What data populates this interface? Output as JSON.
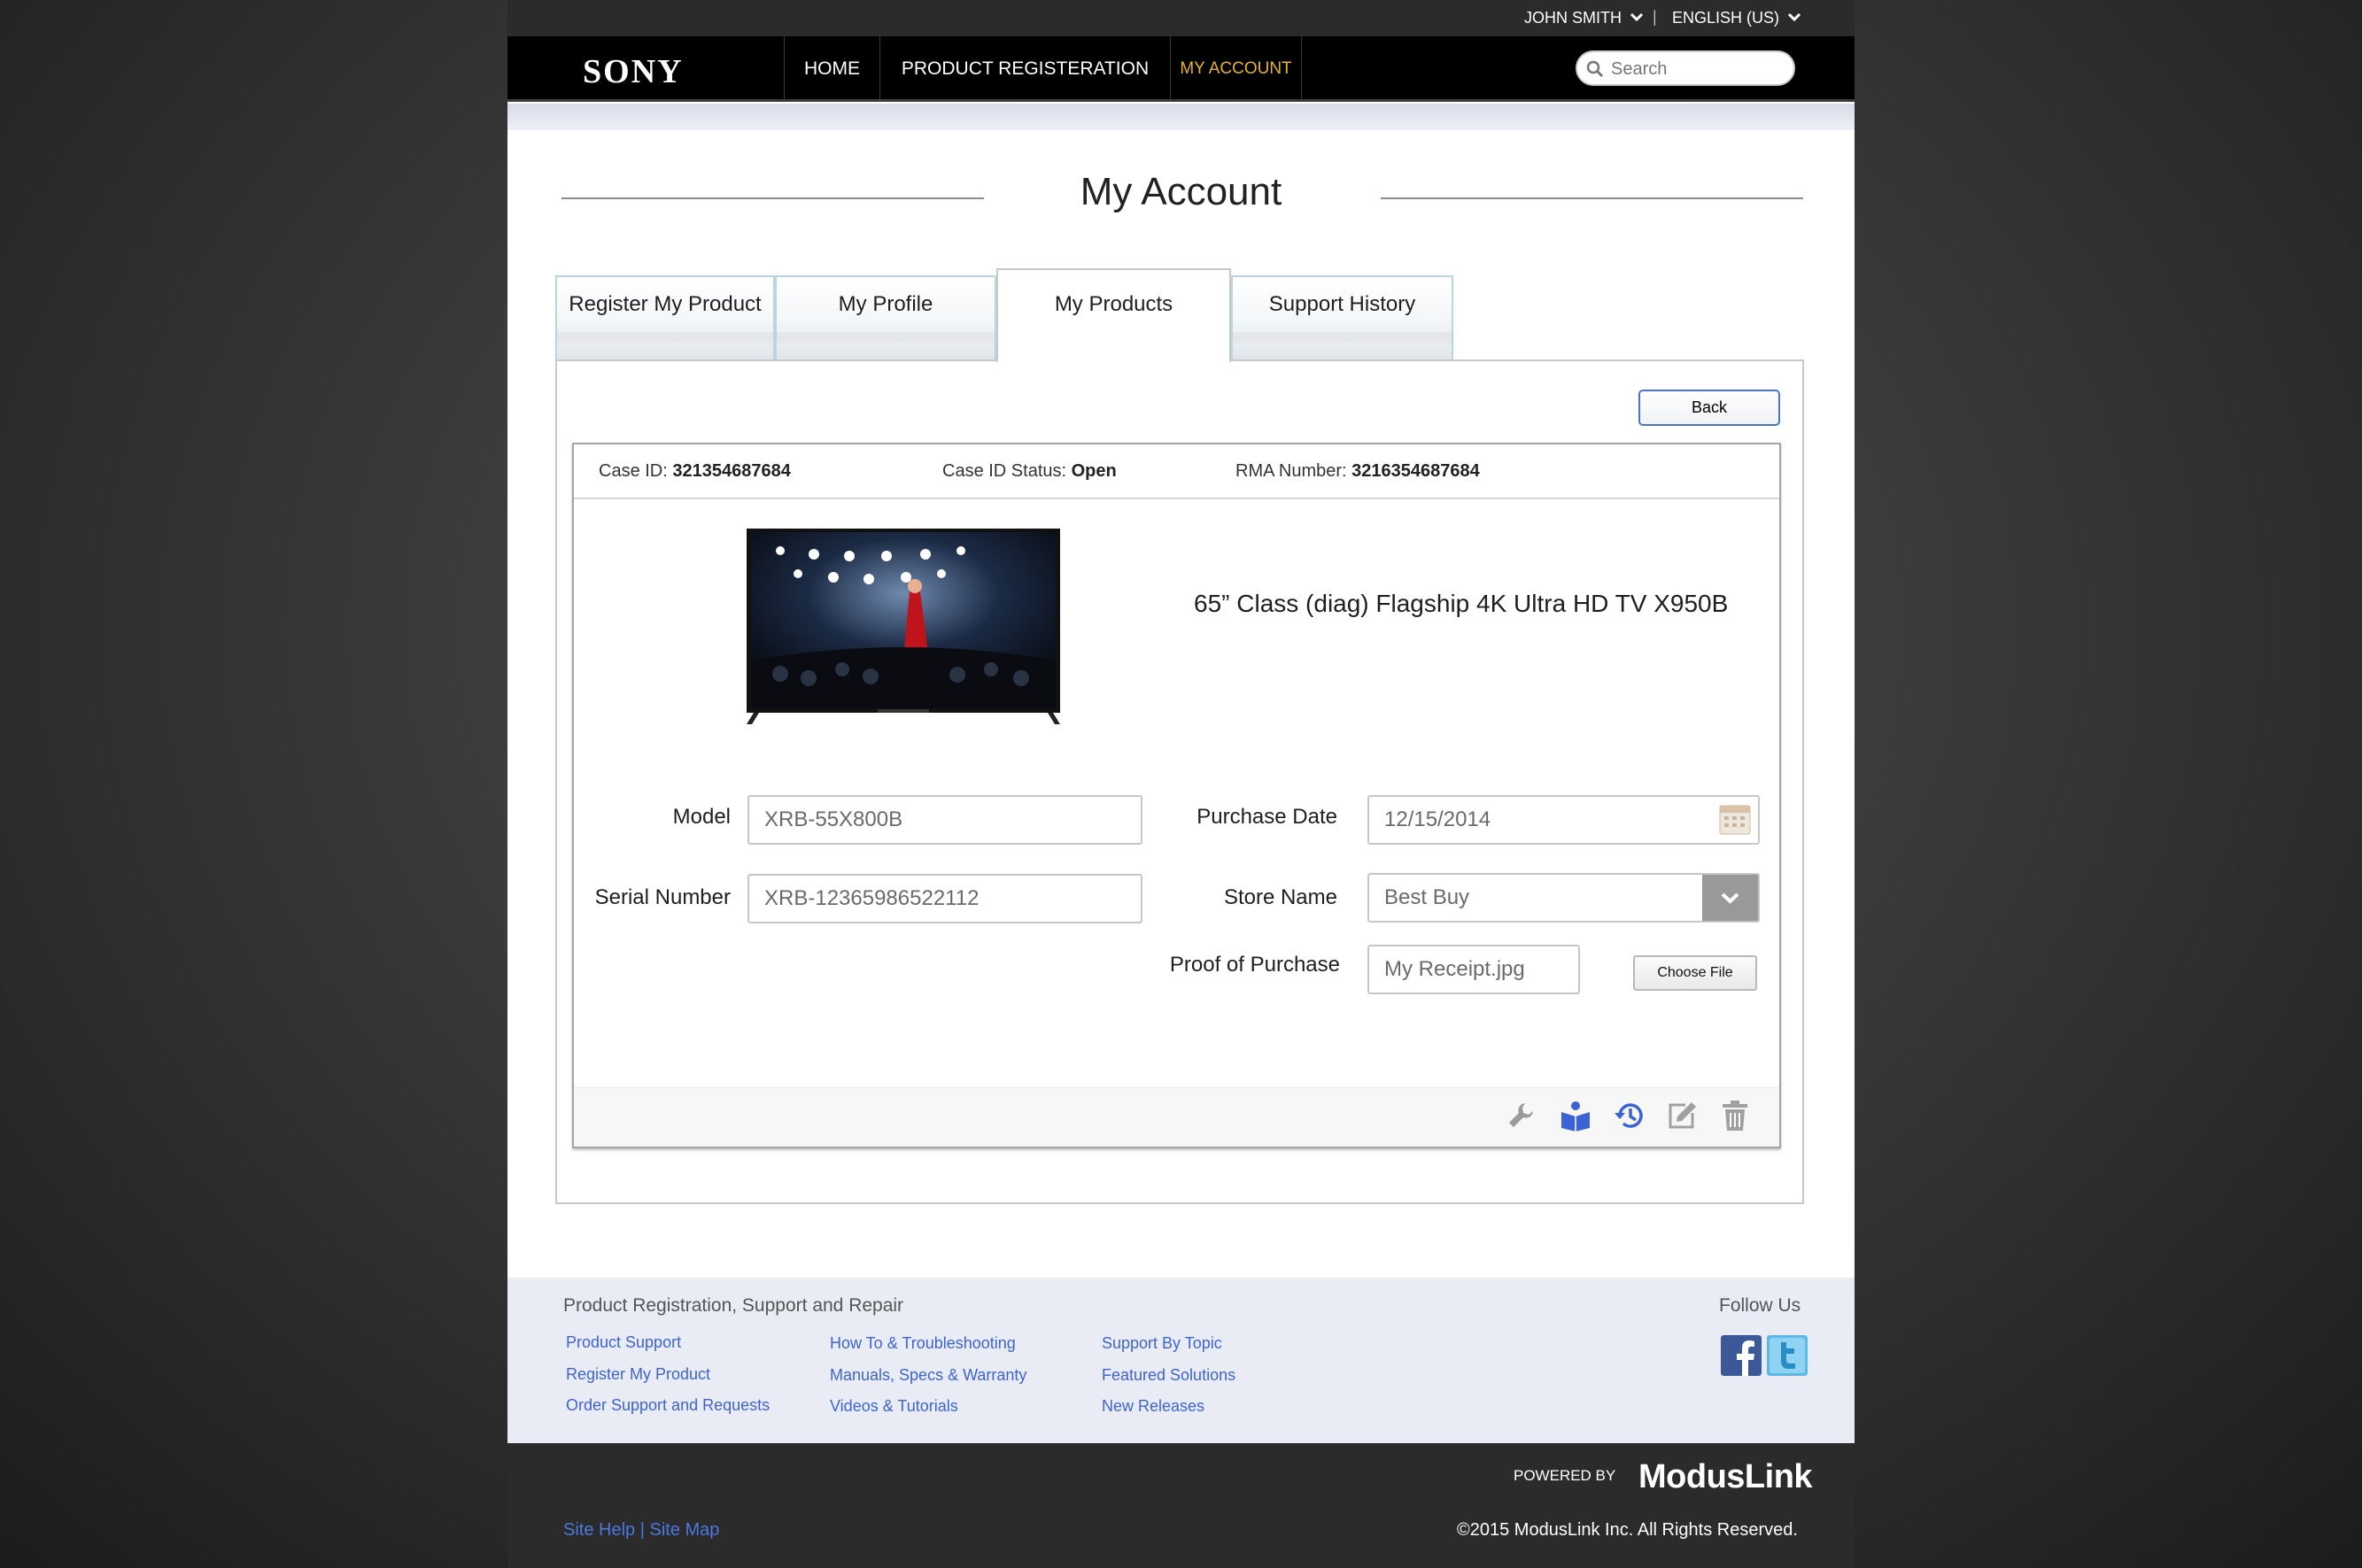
{
  "colors": {
    "accent_nav": "#e6b526",
    "link": "#3e64d4",
    "tab_border": "#b8d6de",
    "button_border": "#4a74c8"
  },
  "topbar": {
    "user": "JOHN SMITH",
    "separator": "|",
    "language": "ENGLISH (US)"
  },
  "nav": {
    "logo": "SONY",
    "items": [
      {
        "label": "HOME",
        "active": false
      },
      {
        "label": "PRODUCT REGISTERATION",
        "active": false
      },
      {
        "label": "MY ACCOUNT",
        "active": true
      }
    ],
    "search_placeholder": "Search"
  },
  "page_title": "My Account",
  "tabs": [
    {
      "label": "Register My Product",
      "active": false
    },
    {
      "label": "My Profile",
      "active": false
    },
    {
      "label": "My Products",
      "active": true
    },
    {
      "label": "Support History",
      "active": false
    }
  ],
  "back_label": "Back",
  "case": {
    "case_id_label": "Case ID:",
    "case_id": "321354687684",
    "status_label": "Case ID Status:",
    "status": "Open",
    "rma_label": "RMA Number:",
    "rma": "3216354687684"
  },
  "product": {
    "name": "65” Class (diag) Flagship 4K Ultra HD TV X950B",
    "image_icon": "tv-product-image"
  },
  "form": {
    "model_label": "Model",
    "model_value": "XRB-55X800B",
    "serial_label": "Serial Number",
    "serial_value": "XRB-12365986522112",
    "purchase_date_label": "Purchase Date",
    "purchase_date_value": "12/15/2014",
    "store_label": "Store Name",
    "store_value": "Best Buy",
    "proof_label": "Proof of Purchase",
    "proof_value": "My Receipt.jpg",
    "choose_file_label": "Choose File"
  },
  "actions": [
    "wrench-icon",
    "manual-icon",
    "history-icon",
    "edit-icon",
    "trash-icon"
  ],
  "footer": {
    "heading": "Product Registration, Support and Repair",
    "col1": [
      "Product Support",
      "Register My Product",
      "Order Support and Requests"
    ],
    "col2": [
      "How To & Troubleshooting",
      "Manuals, Specs & Warranty",
      "Videos & Tutorials"
    ],
    "col3": [
      "Support By Topic",
      "Featured Solutions",
      "New Releases"
    ],
    "follow_label": "Follow Us"
  },
  "bottom": {
    "powered_by": "POWERED BY",
    "brand": "ModusLink",
    "site_help": "Site Help",
    "link_sep": "|",
    "site_map": "Site Map",
    "copyright": "©2015 ModusLink Inc. All Rights Reserved."
  }
}
